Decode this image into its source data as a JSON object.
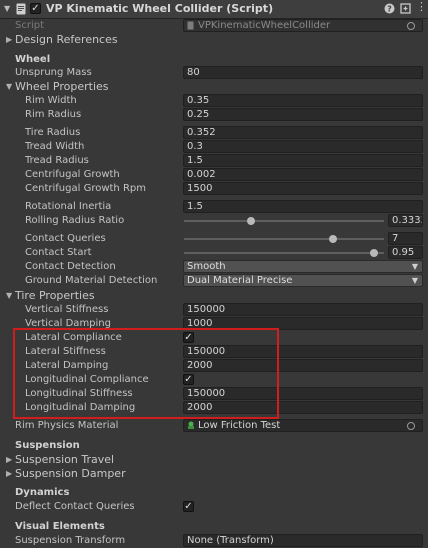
{
  "header": {
    "title": "VP Kinematic Wheel Collider (Script)",
    "enabled": true,
    "icons": [
      "script-icon",
      "help-icon",
      "preset-icon",
      "menu-icon"
    ]
  },
  "script_row": {
    "label": "Script",
    "value": "VPKinematicWheelCollider"
  },
  "design_references": {
    "label": "Design References"
  },
  "wheel": {
    "heading": "Wheel",
    "unsprung_mass": {
      "label": "Unsprung Mass",
      "value": "80"
    }
  },
  "wheel_properties": {
    "label": "Wheel Properties",
    "rim_width": {
      "label": "Rim Width",
      "value": "0.35"
    },
    "rim_radius": {
      "label": "Rim Radius",
      "value": "0.25"
    },
    "tire_radius": {
      "label": "Tire Radius",
      "value": "0.352"
    },
    "tread_width": {
      "label": "Tread Width",
      "value": "0.3"
    },
    "tread_radius": {
      "label": "Tread Radius",
      "value": "1.5"
    },
    "centrifugal_growth": {
      "label": "Centrifugal Growth",
      "value": "0.002"
    },
    "centrifugal_growth_rpm": {
      "label": "Centrifugal Growth Rpm",
      "value": "1500"
    },
    "rotational_inertia": {
      "label": "Rotational Inertia",
      "value": "1.5"
    },
    "rolling_radius_ratio": {
      "label": "Rolling Radius Ratio",
      "value": "0.33333",
      "slider_fraction": 0.335
    },
    "contact_queries": {
      "label": "Contact Queries",
      "value": "7",
      "slider_fraction": 0.745
    },
    "contact_start": {
      "label": "Contact Start",
      "value": "0.95",
      "slider_fraction": 0.95
    },
    "contact_detection": {
      "label": "Contact Detection",
      "value": "Smooth"
    },
    "ground_material_detection": {
      "label": "Ground Material Detection",
      "value": "Dual Material Precise"
    }
  },
  "tire_properties": {
    "label": "Tire Properties",
    "vertical_stiffness": {
      "label": "Vertical Stiffness",
      "value": "150000"
    },
    "vertical_damping": {
      "label": "Vertical Damping",
      "value": "1000"
    },
    "lateral_compliance": {
      "label": "Lateral Compliance",
      "checked": true
    },
    "lateral_stiffness": {
      "label": "Lateral Stiffness",
      "value": "150000"
    },
    "lateral_damping": {
      "label": "Lateral Damping",
      "value": "2000"
    },
    "longitudinal_compliance": {
      "label": "Longitudinal Compliance",
      "checked": true
    },
    "longitudinal_stiffness": {
      "label": "Longitudinal Stiffness",
      "value": "150000"
    },
    "longitudinal_damping": {
      "label": "Longitudinal Damping",
      "value": "2000"
    },
    "rim_physics_material": {
      "label": "Rim Physics Material",
      "value": "Low Friction Test"
    }
  },
  "suspension": {
    "heading": "Suspension",
    "travel": {
      "label": "Suspension Travel"
    },
    "damper": {
      "label": "Suspension Damper"
    }
  },
  "dynamics": {
    "heading": "Dynamics",
    "deflect_contact_queries": {
      "label": "Deflect Contact Queries",
      "checked": true
    }
  },
  "visual_elements": {
    "heading": "Visual Elements",
    "suspension_transform": {
      "label": "Suspension Transform",
      "value": "None (Transform)"
    }
  },
  "colors": {
    "background": "#383838",
    "field": "#2a2a2a",
    "highlight": "#d01d1d"
  }
}
